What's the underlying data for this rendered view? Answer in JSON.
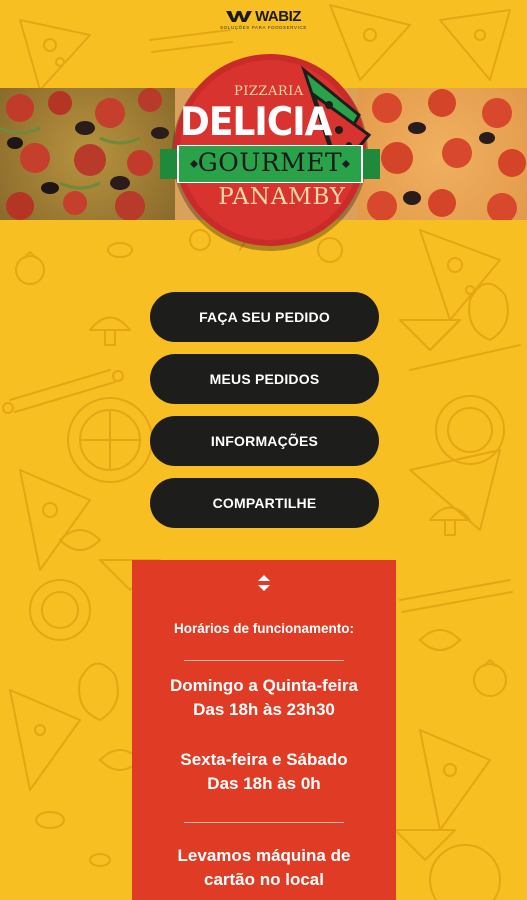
{
  "brand": {
    "name": "WABIZ",
    "tagline": "SOLUÇÕES PARA FOODSERVICE"
  },
  "logo": {
    "pizzaria": "PIZZARIA",
    "delicia": "DELICIA",
    "gourmet": "GOURMET",
    "panamby": "PANAMBY"
  },
  "menu": {
    "items": [
      {
        "label": "FAÇA SEU PEDIDO"
      },
      {
        "label": "MEUS PEDIDOS"
      },
      {
        "label": "INFORMAÇÕES"
      },
      {
        "label": "COMPARTILHE"
      }
    ]
  },
  "info": {
    "heading": "Horários de funcionamento:",
    "schedule_1_days": "Domingo a Quinta-feira",
    "schedule_1_hours": "Das 18h às 23h30",
    "schedule_2_days": "Sexta-feira e Sábado",
    "schedule_2_hours": "Das 18h às 0h",
    "note_1": "Levamos máquina de",
    "note_2": "cartão no local"
  },
  "colors": {
    "background": "#f7bf22",
    "button": "#1d1d1b",
    "card": "#e03b25",
    "ribbon": "#2aa24a",
    "badge": "#d32a2a"
  },
  "icons": {
    "toggle": "expand-collapse-icon",
    "brand": "wabiz-logo-icon"
  }
}
